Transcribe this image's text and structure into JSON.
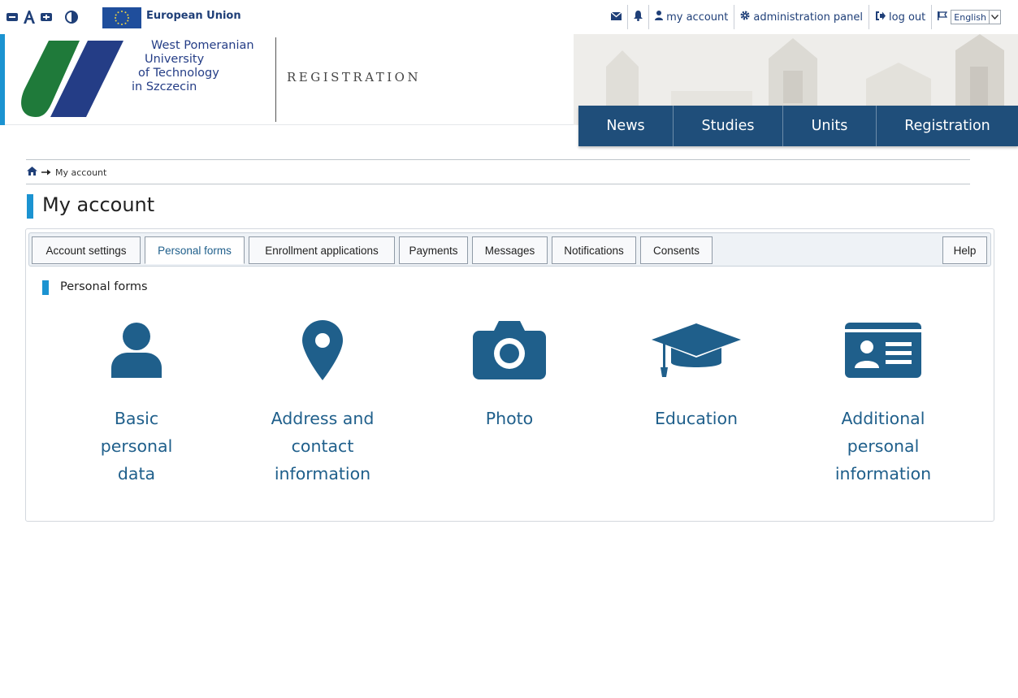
{
  "topbar": {
    "eu_label": "European Union",
    "links": {
      "my_account": "my account",
      "admin_panel": "administration panel",
      "logout": "log out",
      "language": "English"
    },
    "icons": [
      "decrease-font-icon",
      "font-size-icon",
      "increase-font-icon",
      "contrast-icon",
      "envelope-icon",
      "bell-icon",
      "user-icon",
      "gear-icon",
      "logout-icon",
      "flag-icon"
    ]
  },
  "header": {
    "university": {
      "line1": "West Pomeranian",
      "line2": "University",
      "line3": "of Technology",
      "line4": "in Szczecin"
    },
    "section_word": "REGISTRATION",
    "nav": {
      "news": "News",
      "studies": "Studies",
      "units": "Units",
      "registration": "Registration"
    }
  },
  "breadcrumb": {
    "current": "My account"
  },
  "page": {
    "title": "My account"
  },
  "tabs": {
    "account_settings": "Account settings",
    "personal_forms": "Personal forms",
    "enrollment": "Enrollment applications",
    "payments": "Payments",
    "messages": "Messages",
    "notifications": "Notifications",
    "consents": "Consents",
    "help": "Help",
    "active": "personal_forms"
  },
  "section": {
    "title": "Personal forms"
  },
  "tiles": {
    "basic": {
      "l1": "Basic",
      "l2": "personal",
      "l3": "data",
      "icon": "user-icon"
    },
    "address": {
      "l1": "Address and",
      "l2": "contact",
      "l3": "information",
      "icon": "map-pin-icon"
    },
    "photo": {
      "l1": "Photo",
      "icon": "camera-icon"
    },
    "education": {
      "l1": "Education",
      "icon": "graduation-cap-icon"
    },
    "additional": {
      "l1": "Additional",
      "l2": "personal",
      "l3": "information",
      "icon": "id-card-icon"
    }
  },
  "colors": {
    "accent_blue": "#1b93d1",
    "nav_dark": "#1f4e7a",
    "icon_blue": "#1f5f8b",
    "logo_green": "#1f7a3a",
    "logo_navy": "#243d86"
  }
}
